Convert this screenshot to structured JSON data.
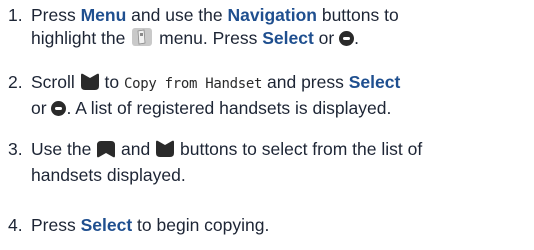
{
  "steps": [
    {
      "num": "1.",
      "line1": [
        "Press ",
        "Menu",
        " and use the ",
        "Navigation",
        " buttons to"
      ],
      "line2": [
        "highlight the ",
        "menu icon",
        " menu. Press ",
        "Select",
        " or ",
        "ok icon",
        "."
      ]
    },
    {
      "num": "2.",
      "line1": [
        "Scroll ",
        "scroll down icon",
        " to ",
        "Copy from Handset",
        " and press ",
        "Select"
      ],
      "line2": [
        "or ",
        "ok icon",
        ". A list of registered handsets is displayed."
      ]
    },
    {
      "num": "3.",
      "line1": [
        "Use the ",
        "scroll up icon",
        " and ",
        "scroll down icon",
        " buttons to select from the list of"
      ],
      "line2": [
        "handsets displayed."
      ]
    },
    {
      "num": "4.",
      "line1": [
        "Press ",
        "Select",
        " to begin copying."
      ]
    }
  ],
  "icons": {
    "menu_icon": "handset-menu-icon",
    "ok_icon": "ok-button-icon",
    "up_icon": "scroll-up-icon",
    "down_icon": "scroll-down-icon"
  }
}
